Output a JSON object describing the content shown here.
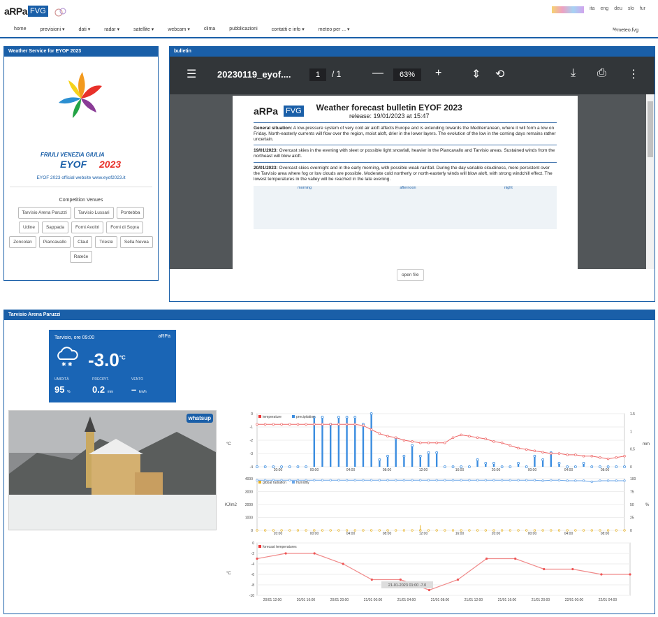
{
  "header": {
    "logo_text": "aRPa",
    "logo_box": "FVG",
    "languages": [
      "ita",
      "eng",
      "deu",
      "slo",
      "fur"
    ],
    "nav": [
      "home",
      "previsioni ▾",
      "dati ▾",
      "radar ▾",
      "satellite ▾",
      "webcam ▾",
      "clima",
      "pubblicazioni",
      "contatti e info ▾",
      "meteo per ... ▾"
    ],
    "nav_right": "ᴹʸmeteo.fvg"
  },
  "left_panel": {
    "title": "Weather Service for EYOF 2023",
    "logo_line1": "FRIULI VENEZIA GIULIA",
    "logo_line2": "EYOF",
    "logo_line3": "2023",
    "website": "EYOF 2023 official website www.eyof2023.it",
    "venues_title": "Competition Venues",
    "venues": [
      "Tarvisio Arena Paruzzi",
      "Tarvisio Lussari",
      "Pontebba",
      "Udine",
      "Sappada",
      "Forni Avoltri",
      "Forni di Sopra",
      "Zoncolan",
      "Piancavallo",
      "Claut",
      "Trieste",
      "Sella Nevea",
      "Rateče"
    ]
  },
  "bulletin": {
    "title": "bulletin",
    "filename": "20230119_eyof....",
    "page": "1",
    "of": "/ 1",
    "zoom": "63%",
    "doc_title": "Weather forecast bulletin EYOF 2023",
    "release": "release: 19/01/2023 at 15:47",
    "general": "General situation:",
    "general_text": "A low-pressure system of very cold air aloft affects Europe and is extending towards the Mediterranean, where it will form a low on Friday. North-easterly currents will flow over the region, moist aloft, drier in the lower layers. The evolution of the low in the coming days remains rather uncertain.",
    "d1": "19/01/2023:",
    "d1_text": "Overcast skies in the evening with sleet or possible light snowfall, heavier in the Piancavallo and Tarvisio areas. Sustained winds from the northeast will blow aloft.",
    "d2": "20/01/2023:",
    "d2_text": "Overcast skies overnight and in the early morning, with possible weak rainfall. During the day variable cloudiness, more persistent over the Tarvisio area where fog or low clouds are possible. Moderate cold northerly or north-easterly winds will blow aloft, with strong windchill effect. The lowest temperatures in the valley will be reached in the late evening.",
    "periods": [
      "morning",
      "afternoon",
      "night"
    ],
    "open_file": "open file"
  },
  "station": {
    "panel_title": "Tarvisio Arena Paruzzi",
    "location": "Tarvisio, ore 09:00",
    "temp": "-3.0",
    "temp_unit": "°C",
    "labels": [
      "UMIDITÀ",
      "PRECIPIT.",
      "VENTO"
    ],
    "humidity": "95",
    "humidity_unit": "%",
    "precip": "0.2",
    "precip_unit": "mm",
    "wind": "–",
    "wind_unit": "km/h",
    "webcam_brand": "whatsup"
  },
  "chart_data": [
    {
      "type": "line",
      "title": "",
      "series": [
        {
          "name": "temperature"
        },
        {
          "name": "precipitation"
        }
      ],
      "ylabel_left": "°C",
      "ylabel_right": "mm",
      "ylim_left": [
        -4,
        0
      ],
      "ylim_right": [
        0,
        1.5
      ],
      "x_ticks": [
        "20:00",
        "00:00",
        "04:00",
        "08:00",
        "12:00",
        "16:00",
        "20:00",
        "00:00",
        "04:00",
        "08:00"
      ],
      "temperature": [
        -0.8,
        -0.8,
        -0.8,
        -0.8,
        -0.8,
        -0.8,
        -0.8,
        -0.8,
        -0.8,
        -0.8,
        -0.8,
        -0.8,
        -0.8,
        -0.9,
        -1.2,
        -1.5,
        -1.7,
        -1.8,
        -2.0,
        -2.1,
        -2.2,
        -2.2,
        -2.2,
        -2.2,
        -1.8,
        -1.6,
        -1.7,
        -1.8,
        -1.9,
        -2.1,
        -2.2,
        -2.4,
        -2.6,
        -2.7,
        -2.8,
        -2.9,
        -3.0,
        -3.0,
        -3.1,
        -3.1,
        -3.2,
        -3.2,
        -3.3,
        -3.4,
        -3.3,
        -3.2
      ],
      "precipitation": [
        0,
        0,
        0,
        0,
        0,
        0,
        0,
        1.4,
        1.4,
        1.2,
        1.4,
        1.4,
        1.4,
        1.2,
        1.5,
        0.2,
        0.3,
        0.8,
        0.3,
        0.6,
        0.3,
        0.4,
        0.4,
        0,
        0,
        0,
        0,
        0.2,
        0.1,
        0.1,
        0,
        0,
        0.1,
        0,
        0.3,
        0.2,
        0.4,
        0.1,
        0,
        0,
        0.1,
        0,
        0,
        0,
        0,
        0
      ]
    },
    {
      "type": "line",
      "series": [
        {
          "name": "global radiation"
        },
        {
          "name": "humidity"
        }
      ],
      "ylabel_left": "KJ/m2",
      "ylabel_right": "%",
      "ylim_left": [
        0,
        4000
      ],
      "ylim_right": [
        0,
        100
      ],
      "radiation_peak": 400,
      "humidity": [
        97,
        97,
        97,
        97,
        97,
        97,
        97,
        97,
        97,
        97,
        97,
        97,
        97,
        97,
        97,
        97,
        97,
        97,
        97,
        97,
        97,
        97,
        97,
        97,
        97,
        97,
        97,
        97,
        97,
        97,
        97,
        97,
        97,
        97,
        97,
        96,
        97,
        97,
        96,
        96,
        96,
        94,
        96,
        96,
        96,
        96
      ]
    },
    {
      "type": "line",
      "series": [
        {
          "name": "forecast temperatures"
        }
      ],
      "ylabel": "°C",
      "ylim": [
        -10,
        0
      ],
      "x_ticks": [
        "20/01 12:00",
        "20/01 16:00",
        "20/01 20:00",
        "21/01 00:00",
        "21/01 04:00",
        "21/01 08:00",
        "21/01 12:00",
        "21/01 16:00",
        "21/01 20:00",
        "22/01 00:00",
        "22/01 04:00"
      ],
      "tooltip": "21-01-2023 01:00 -7.0",
      "values": [
        -3,
        -2,
        -2,
        -4,
        -7,
        -7,
        -9,
        -7,
        -3,
        -3,
        -5,
        -5,
        -6,
        -6
      ]
    }
  ]
}
